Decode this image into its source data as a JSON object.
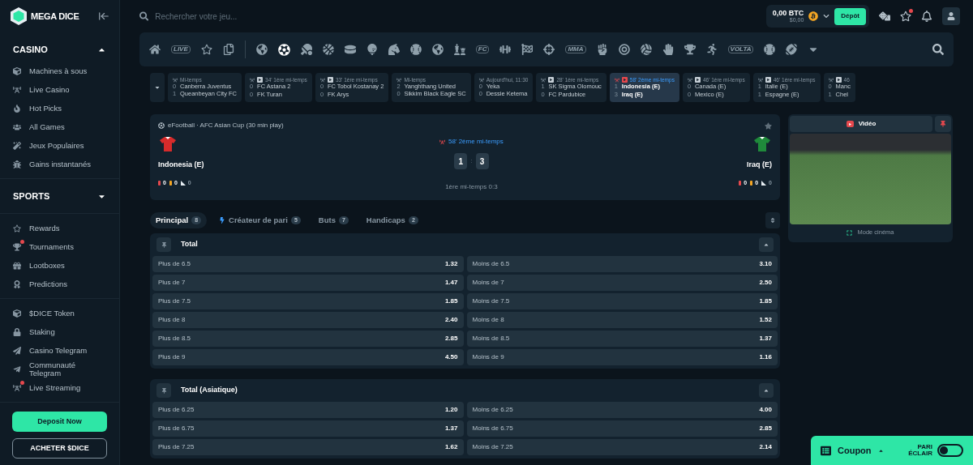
{
  "brand": {
    "name": "MEGA DICE"
  },
  "sidebar": {
    "sections": [
      {
        "title": "CASINO",
        "expanded": true,
        "items": [
          {
            "label": "Machines à sous",
            "alert": false
          },
          {
            "label": "Live Casino",
            "alert": false
          },
          {
            "label": "Hot Picks",
            "alert": false
          },
          {
            "label": "All Games",
            "alert": false
          },
          {
            "label": "Jeux Populaires",
            "alert": false
          },
          {
            "label": "Gains instantanés",
            "alert": false
          }
        ]
      },
      {
        "title": "SPORTS",
        "expanded": false
      },
      {
        "items": [
          {
            "label": "Rewards",
            "alert": false
          },
          {
            "label": "Tournaments",
            "alert": true
          },
          {
            "label": "Lootboxes",
            "alert": false
          },
          {
            "label": "Predictions",
            "alert": false
          }
        ]
      },
      {
        "items": [
          {
            "label": "$DICE Token",
            "alert": false
          },
          {
            "label": "Staking",
            "alert": false
          },
          {
            "label": "Casino Telegram",
            "alert": false
          },
          {
            "label": "Communauté Telegram",
            "alert": false
          },
          {
            "label": "Live Streaming",
            "alert": true
          }
        ]
      }
    ],
    "buttons": [
      {
        "kind": "primary",
        "label": "Deposit Now"
      },
      {
        "kind": "outline",
        "label": "ACHETER $DICE"
      }
    ]
  },
  "header": {
    "search": {
      "placeholder": "Rechercher votre jeu..."
    },
    "balance": "0,00 BTC",
    "balance_fiat": "$0,00",
    "deposit": "Dépôt",
    "favorites_alert": true
  },
  "sport_bar": [
    {
      "kind": "icon",
      "selected": false
    },
    {
      "kind": "text",
      "label": "LIVE",
      "selected": false
    },
    {
      "kind": "icon",
      "selected": false
    },
    {
      "kind": "icon",
      "selected": false
    },
    {
      "kind": "divider"
    },
    {
      "kind": "icon",
      "selected": false
    },
    {
      "kind": "icon",
      "selected": true
    },
    {
      "kind": "icon",
      "selected": false
    },
    {
      "kind": "icon",
      "selected": false
    },
    {
      "kind": "icon",
      "selected": false
    },
    {
      "kind": "icon",
      "selected": false
    },
    {
      "kind": "icon",
      "selected": false
    },
    {
      "kind": "icon",
      "selected": false
    },
    {
      "kind": "icon",
      "selected": false
    },
    {
      "kind": "icon",
      "selected": false
    },
    {
      "kind": "text",
      "label": "FC",
      "selected": false
    },
    {
      "kind": "icon",
      "selected": false
    },
    {
      "kind": "icon",
      "selected": false
    },
    {
      "kind": "icon",
      "selected": false
    },
    {
      "kind": "text",
      "label": "MMA",
      "selected": false
    },
    {
      "kind": "icon",
      "selected": false
    },
    {
      "kind": "icon",
      "selected": false
    },
    {
      "kind": "icon",
      "selected": false
    },
    {
      "kind": "icon",
      "selected": false
    },
    {
      "kind": "icon",
      "selected": false
    },
    {
      "kind": "icon",
      "selected": false
    },
    {
      "kind": "text",
      "label": "VOLTA",
      "selected": false
    },
    {
      "kind": "icon",
      "selected": false
    },
    {
      "kind": "icon",
      "selected": false
    },
    {
      "kind": "icon",
      "selected": false
    }
  ],
  "live_strip": [
    {
      "status": "Mi-temps",
      "video": false,
      "selected": false,
      "teams": [
        {
          "score": "0",
          "name": "Canberra Juventus"
        },
        {
          "score": "1",
          "name": "Queanbeyan City FC"
        }
      ]
    },
    {
      "status": "34' 1ère mi-temps",
      "video": true,
      "selected": false,
      "teams": [
        {
          "score": "0",
          "name": "FC Astana 2"
        },
        {
          "score": "0",
          "name": "FK Turan"
        }
      ]
    },
    {
      "status": "33' 1ère mi-temps",
      "video": true,
      "selected": false,
      "teams": [
        {
          "score": "0",
          "name": "FC Tobol Kostanay 2"
        },
        {
          "score": "0",
          "name": "FK Arys"
        }
      ]
    },
    {
      "status": "Mi-temps",
      "video": false,
      "selected": false,
      "teams": [
        {
          "score": "2",
          "name": "Yanghthang United"
        },
        {
          "score": "0",
          "name": "Sikkim Black Eagle SC"
        }
      ]
    },
    {
      "status": "Aujourd'hui, 11:30",
      "video": false,
      "selected": false,
      "teams": [
        {
          "score": "0",
          "name": "Yeka"
        },
        {
          "score": "0",
          "name": "Dessie Ketema"
        }
      ]
    },
    {
      "status": "28' 1ère mi-temps",
      "video": true,
      "selected": false,
      "teams": [
        {
          "score": "1",
          "name": "SK Sigma Olomouc"
        },
        {
          "score": "0",
          "name": "FC Pardubice"
        }
      ]
    },
    {
      "status": "58' 2ème mi-temps",
      "video": true,
      "selected": true,
      "teams": [
        {
          "score": "1",
          "name": "Indonesia (E)"
        },
        {
          "score": "3",
          "name": "Iraq (E)"
        }
      ]
    },
    {
      "status": "46' 1ère mi-temps",
      "video": true,
      "selected": false,
      "teams": [
        {
          "score": "0",
          "name": "Canada (E)"
        },
        {
          "score": "0",
          "name": "Mexico (E)"
        }
      ]
    },
    {
      "status": "46' 1ère mi-temps",
      "video": true,
      "selected": false,
      "teams": [
        {
          "score": "1",
          "name": "Italie (E)"
        },
        {
          "score": "1",
          "name": "Espagne (E)"
        }
      ]
    },
    {
      "status": "46",
      "video": true,
      "selected": false,
      "teams": [
        {
          "score": "0",
          "name": "Manc"
        },
        {
          "score": "1",
          "name": "Chel"
        }
      ]
    }
  ],
  "match": {
    "league": "eFootball · AFC Asian Cup (30 min play)",
    "favorite": false,
    "status": "58' 2ème mi-temps",
    "home": {
      "name": "Indonesia (E)",
      "color": "#d62b2b",
      "score": "1",
      "stats": [
        {
          "kind": "red_card",
          "value": "0"
        },
        {
          "kind": "yellow_card",
          "value": "0"
        },
        {
          "kind": "corner",
          "value": "0"
        }
      ]
    },
    "separator": ":",
    "away": {
      "name": "Iraq (E)",
      "color": "#1f8a3b",
      "score": "3",
      "stats": [
        {
          "kind": "red_card",
          "value": "0"
        },
        {
          "kind": "yellow_card",
          "value": "0"
        },
        {
          "kind": "corner",
          "value": "0"
        }
      ]
    },
    "period_score": "1ère mi-temps 0:3"
  },
  "market_tabs": [
    {
      "label": "Principal",
      "count": "8",
      "selected": true,
      "kind": "plain"
    },
    {
      "label": "Créateur de pari",
      "count": "5",
      "selected": false,
      "kind": "builder"
    },
    {
      "label": "Buts",
      "count": "7",
      "selected": false,
      "kind": "plain"
    },
    {
      "label": "Handicaps",
      "count": "2",
      "selected": false,
      "kind": "plain"
    }
  ],
  "markets": [
    {
      "title": "Total",
      "expanded": true,
      "rows": [
        [
          {
            "label": "Plus de 6.5",
            "odds": "1.32"
          },
          {
            "label": "Moins de 6.5",
            "odds": "3.10"
          }
        ],
        [
          {
            "label": "Plus de 7",
            "odds": "1.47"
          },
          {
            "label": "Moins de 7",
            "odds": "2.50"
          }
        ],
        [
          {
            "label": "Plus de 7.5",
            "odds": "1.85"
          },
          {
            "label": "Moins de 7.5",
            "odds": "1.85"
          }
        ],
        [
          {
            "label": "Plus de 8",
            "odds": "2.40"
          },
          {
            "label": "Moins de 8",
            "odds": "1.52"
          }
        ],
        [
          {
            "label": "Plus de 8.5",
            "odds": "2.85"
          },
          {
            "label": "Moins de 8.5",
            "odds": "1.37"
          }
        ],
        [
          {
            "label": "Plus de 9",
            "odds": "4.50"
          },
          {
            "label": "Moins de 9",
            "odds": "1.16"
          }
        ]
      ]
    },
    {
      "title": "Total (Asiatique)",
      "expanded": true,
      "rows": [
        [
          {
            "label": "Plus de 6.25",
            "odds": "1.20"
          },
          {
            "label": "Moins de 6.25",
            "odds": "4.00"
          }
        ],
        [
          {
            "label": "Plus de 6.75",
            "odds": "1.37"
          },
          {
            "label": "Moins de 6.75",
            "odds": "2.85"
          }
        ],
        [
          {
            "label": "Plus de 7.25",
            "odds": "1.62"
          },
          {
            "label": "Moins de 7.25",
            "odds": "2.14"
          }
        ]
      ]
    }
  ],
  "video": {
    "title": "Vidéo",
    "pinned": true,
    "cinema": "Mode cinéma"
  },
  "coupon": {
    "label": "Coupon",
    "quick_bet_label": "PARI ÉCLAIR",
    "quick_bet_on": false
  }
}
